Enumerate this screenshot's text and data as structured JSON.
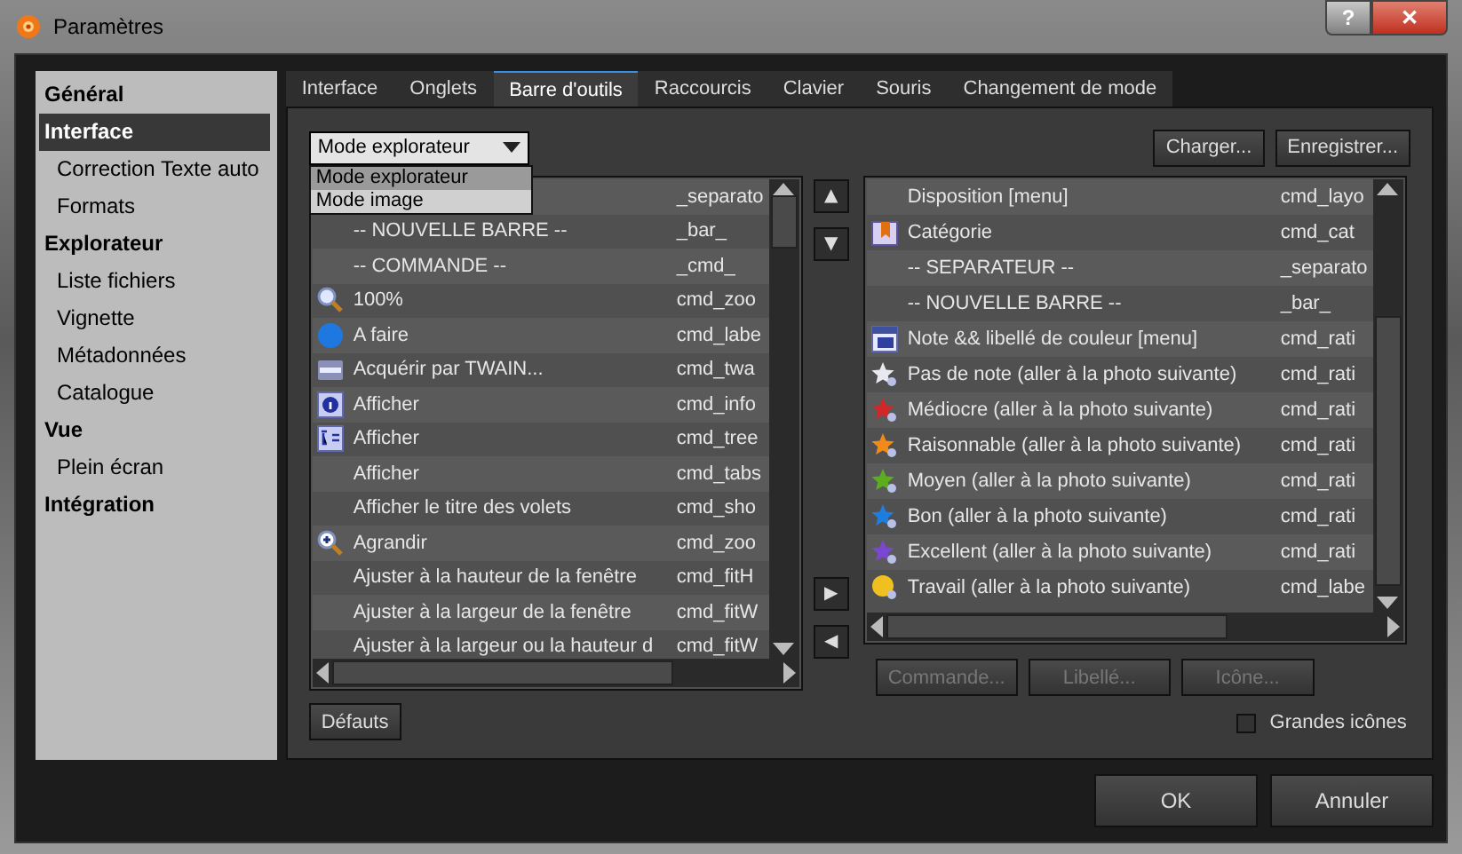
{
  "window": {
    "title": "Paramètres",
    "buttons": [
      "?",
      "✕"
    ]
  },
  "sidebar": {
    "items": [
      {
        "label": "Général",
        "kind": "header",
        "selected": false
      },
      {
        "label": "Interface",
        "kind": "header",
        "selected": true
      },
      {
        "label": "Correction Texte auto",
        "kind": "child",
        "selected": false
      },
      {
        "label": "Formats",
        "kind": "child",
        "selected": false
      },
      {
        "label": "Explorateur",
        "kind": "header",
        "selected": false
      },
      {
        "label": "Liste fichiers",
        "kind": "child",
        "selected": false
      },
      {
        "label": "Vignette",
        "kind": "child",
        "selected": false
      },
      {
        "label": "Métadonnées",
        "kind": "child",
        "selected": false
      },
      {
        "label": "Catalogue",
        "kind": "child",
        "selected": false
      },
      {
        "label": "Vue",
        "kind": "header",
        "selected": false
      },
      {
        "label": "Plein écran",
        "kind": "child",
        "selected": false
      },
      {
        "label": "Intégration",
        "kind": "header",
        "selected": false
      }
    ]
  },
  "tabs": [
    {
      "label": "Interface",
      "selected": false
    },
    {
      "label": "Onglets",
      "selected": false
    },
    {
      "label": "Barre d'outils",
      "selected": true
    },
    {
      "label": "Raccourcis",
      "selected": false
    },
    {
      "label": "Clavier",
      "selected": false
    },
    {
      "label": "Souris",
      "selected": false
    },
    {
      "label": "Changement de mode",
      "selected": false
    }
  ],
  "mode_select": {
    "value": "Mode explorateur",
    "expanded": true,
    "options": [
      {
        "label": "Mode explorateur",
        "selected": true
      },
      {
        "label": "Mode image",
        "selected": false
      }
    ]
  },
  "top_buttons": [
    "Charger...",
    "Enregistrer..."
  ],
  "available_list": {
    "rows": [
      {
        "kind": "plain",
        "label": "",
        "command": "_separato"
      },
      {
        "kind": "plain",
        "label": "-- NOUVELLE BARRE --",
        "command": "_bar_"
      },
      {
        "kind": "plain",
        "label": "-- COMMANDE --",
        "command": "_cmd_"
      },
      {
        "kind": "zoom",
        "label": "100%",
        "command": "cmd_zoo"
      },
      {
        "kind": "dot",
        "label": "A faire",
        "command": "cmd_labe"
      },
      {
        "kind": "scanner",
        "label": "Acquérir par TWAIN...",
        "command": "cmd_twa"
      },
      {
        "kind": "info",
        "label": "Afficher",
        "command": "cmd_info"
      },
      {
        "kind": "tree",
        "label": "Afficher",
        "command": "cmd_tree"
      },
      {
        "kind": "plain",
        "label": "Afficher",
        "command": "cmd_tabs"
      },
      {
        "kind": "plain",
        "label": "Afficher le titre des volets",
        "command": "cmd_sho"
      },
      {
        "kind": "zoom-in",
        "label": "Agrandir",
        "command": "cmd_zoo"
      },
      {
        "kind": "plain",
        "label": "Ajuster à la hauteur de la fenêtre",
        "command": "cmd_fitH"
      },
      {
        "kind": "plain",
        "label": "Ajuster à la largeur de la fenêtre",
        "command": "cmd_fitW"
      },
      {
        "kind": "plain",
        "label": "Ajuster à la largeur ou la hauteur d",
        "command": "cmd_fitW"
      }
    ]
  },
  "move_buttons": [
    "▲",
    "▼",
    "▶",
    "◀"
  ],
  "toolbar_list": {
    "rows": [
      {
        "kind": "plain",
        "label": "Disposition [menu]",
        "command": "cmd_layo"
      },
      {
        "kind": "category",
        "label": "Catégorie",
        "command": "cmd_cat"
      },
      {
        "kind": "plain",
        "label": "-- SEPARATEUR --",
        "command": "_separato"
      },
      {
        "kind": "plain",
        "label": "-- NOUVELLE BARRE --",
        "command": "_bar_"
      },
      {
        "kind": "rating-menu",
        "label": "Note && libellé de couleur [menu]",
        "command": "cmd_rati"
      },
      {
        "kind": "star",
        "color": "#e8e8f0",
        "label": "Pas de note (aller à la photo suivante)",
        "command": "cmd_rati"
      },
      {
        "kind": "star",
        "color": "#d02828",
        "label": "Médiocre (aller à la photo suivante)",
        "command": "cmd_rati"
      },
      {
        "kind": "star",
        "color": "#f08a18",
        "label": "Raisonnable (aller à la photo suivante)",
        "command": "cmd_rati"
      },
      {
        "kind": "star",
        "color": "#5cae1e",
        "label": "Moyen (aller à la photo suivante)",
        "command": "cmd_rati"
      },
      {
        "kind": "star",
        "color": "#1e7ee0",
        "label": "Bon (aller à la photo suivante)",
        "command": "cmd_rati"
      },
      {
        "kind": "star",
        "color": "#7a48d0",
        "label": "Excellent (aller à la photo suivante)",
        "command": "cmd_rati"
      },
      {
        "kind": "label",
        "label": "Travail (aller à la photo suivante)",
        "command": "cmd_labe"
      }
    ]
  },
  "edit_buttons": [
    {
      "label": "Commande...",
      "disabled": true
    },
    {
      "label": "Libellé...",
      "disabled": true
    },
    {
      "label": "Icône...",
      "disabled": true
    }
  ],
  "defaults_button": "Défauts",
  "large_icons": {
    "label": "Grandes icônes",
    "checked": false
  },
  "dialog_buttons": [
    "OK",
    "Annuler"
  ]
}
